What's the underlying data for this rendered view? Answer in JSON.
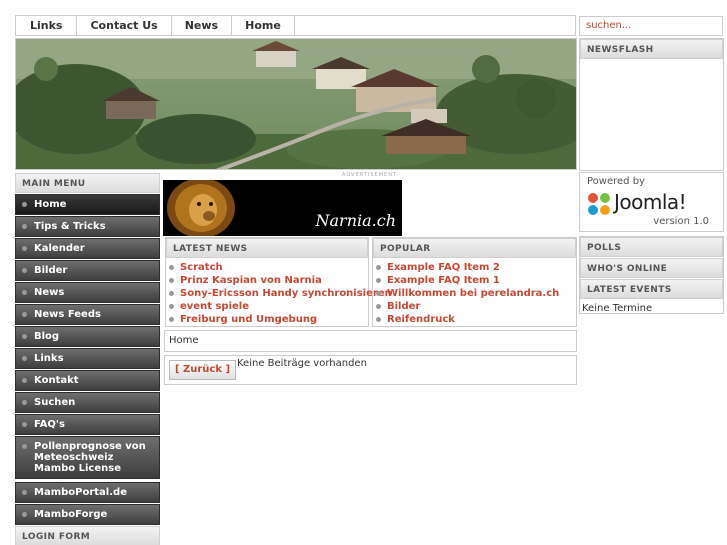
{
  "topnav": {
    "items": [
      "Links",
      "Contact Us",
      "News",
      "Home"
    ]
  },
  "search": {
    "placeholder": "suchen..."
  },
  "newsflash": {
    "title": "NEWSFLASH"
  },
  "mainmenu": {
    "title": "MAIN MENU",
    "items": [
      "Home",
      "Tips & Tricks",
      "Kalender",
      "Bilder",
      "News",
      "News Feeds",
      "Blog",
      "Links",
      "Kontakt",
      "Suchen",
      "FAQ's",
      "Pollenprognose von Meteoschweiz",
      "Mambo License",
      "MamboPortal.de",
      "MamboForge"
    ]
  },
  "loginform": {
    "title": "LOGIN FORM"
  },
  "ad": {
    "label": "ADVERTISEMENT",
    "banner_text": "Narnia.ch"
  },
  "latestnews": {
    "title": "LATEST NEWS",
    "items": [
      "Scratch",
      "Prinz Kaspian von Narnia",
      "Sony-Ericsson Handy synchronisieren",
      "event spiele",
      "Freiburg und Umgebung"
    ]
  },
  "popular": {
    "title": "POPULAR",
    "items": [
      "Example FAQ Item 2",
      "Example FAQ Item 1",
      "Willkommen bei perelandra.ch",
      "Bilder",
      "Reifendruck"
    ]
  },
  "pathway": {
    "text": "Home"
  },
  "content": {
    "back_label": "[ Zurück ]",
    "message": "Keine Beiträge vorhanden"
  },
  "powered": {
    "by": "Powered by",
    "brand": "Joomla!",
    "version": "version 1.0"
  },
  "right": {
    "polls": "POLLS",
    "whos_online": "WHO'S ONLINE",
    "latest_events": "LATEST EVENTS",
    "events_text": "Keine Termine"
  },
  "colors": {
    "link": "#c64934",
    "menu_dark": "#3e3e3e",
    "border": "#cccccc"
  }
}
